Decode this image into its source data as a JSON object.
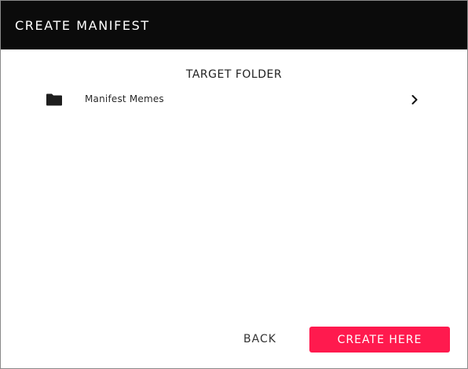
{
  "dialog": {
    "title": "CREATE MANIFEST"
  },
  "target": {
    "heading": "TARGET FOLDER",
    "folder": {
      "name": "Manifest Memes",
      "icon": "folder-icon",
      "trailing_icon": "chevron-right-icon"
    }
  },
  "actions": {
    "back_label": "BACK",
    "create_label": "CREATE HERE"
  },
  "colors": {
    "header_bg": "#0b0b0b",
    "accent": "#ff1a4e"
  }
}
